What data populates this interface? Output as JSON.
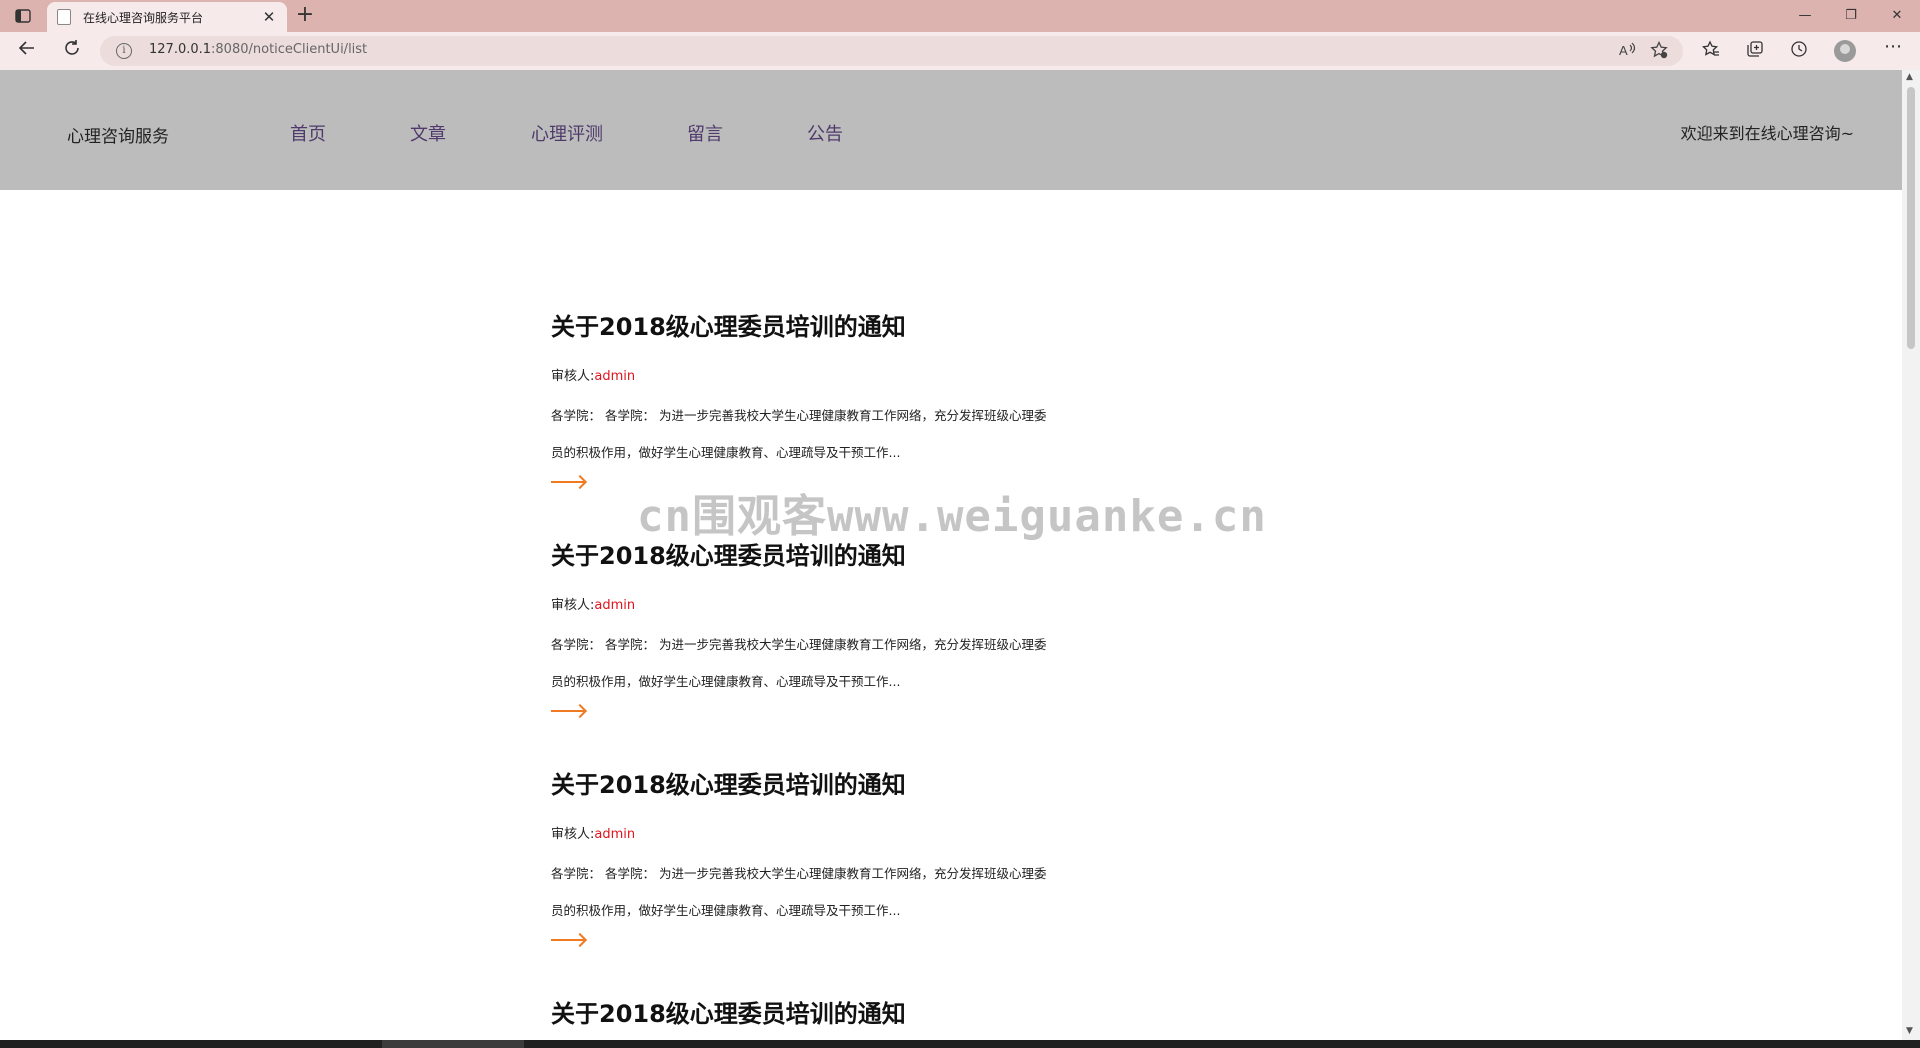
{
  "browser": {
    "tab_title": "在线心理咨询服务平台",
    "tab_close": "✕",
    "new_tab": "+",
    "url_host": "127.0.0.1",
    "url_rest": ":8080/noticeClientUi/list",
    "info_icon": "i",
    "icons": [
      "read-aloud-icon",
      "favorite-add-icon",
      "favorites-icon",
      "collections-icon",
      "history-icon",
      "profile-icon",
      "more-icon"
    ],
    "win_minimize": "—",
    "win_restore": "❐",
    "win_close": "✕"
  },
  "site": {
    "brand": "心理咨询服务",
    "nav": [
      {
        "label": "首页"
      },
      {
        "label": "文章"
      },
      {
        "label": "心理评测"
      },
      {
        "label": "留言"
      },
      {
        "label": "公告"
      }
    ],
    "welcome": "欢迎来到在线心理咨询~"
  },
  "notices": [
    {
      "title": "关于2018级心理委员培训的通知",
      "reviewer_label": "审核人:",
      "reviewer": "admin",
      "excerpt": "各学院： 各学院： 为进一步完善我校大学生心理健康教育工作网络，充分发挥班级心理委员的积极作用，做好学生心理健康教育、心理疏导及干预工作..."
    },
    {
      "title": "关于2018级心理委员培训的通知",
      "reviewer_label": "审核人:",
      "reviewer": "admin",
      "excerpt": "各学院： 各学院： 为进一步完善我校大学生心理健康教育工作网络，充分发挥班级心理委员的积极作用，做好学生心理健康教育、心理疏导及干预工作..."
    },
    {
      "title": "关于2018级心理委员培训的通知",
      "reviewer_label": "审核人:",
      "reviewer": "admin",
      "excerpt": "各学院： 各学院： 为进一步完善我校大学生心理健康教育工作网络，充分发挥班级心理委员的积极作用，做好学生心理健康教育、心理疏导及干预工作..."
    },
    {
      "title": "关于2018级心理委员培训的通知"
    }
  ],
  "watermark": "cn围观客www.weiguanke.cn",
  "colors": {
    "tabbar": "#dcb3ae",
    "header": "#bcbcbc",
    "nav_link": "#4f3a6b",
    "reviewer": "#e0141e",
    "arrow": "#f07a22"
  }
}
